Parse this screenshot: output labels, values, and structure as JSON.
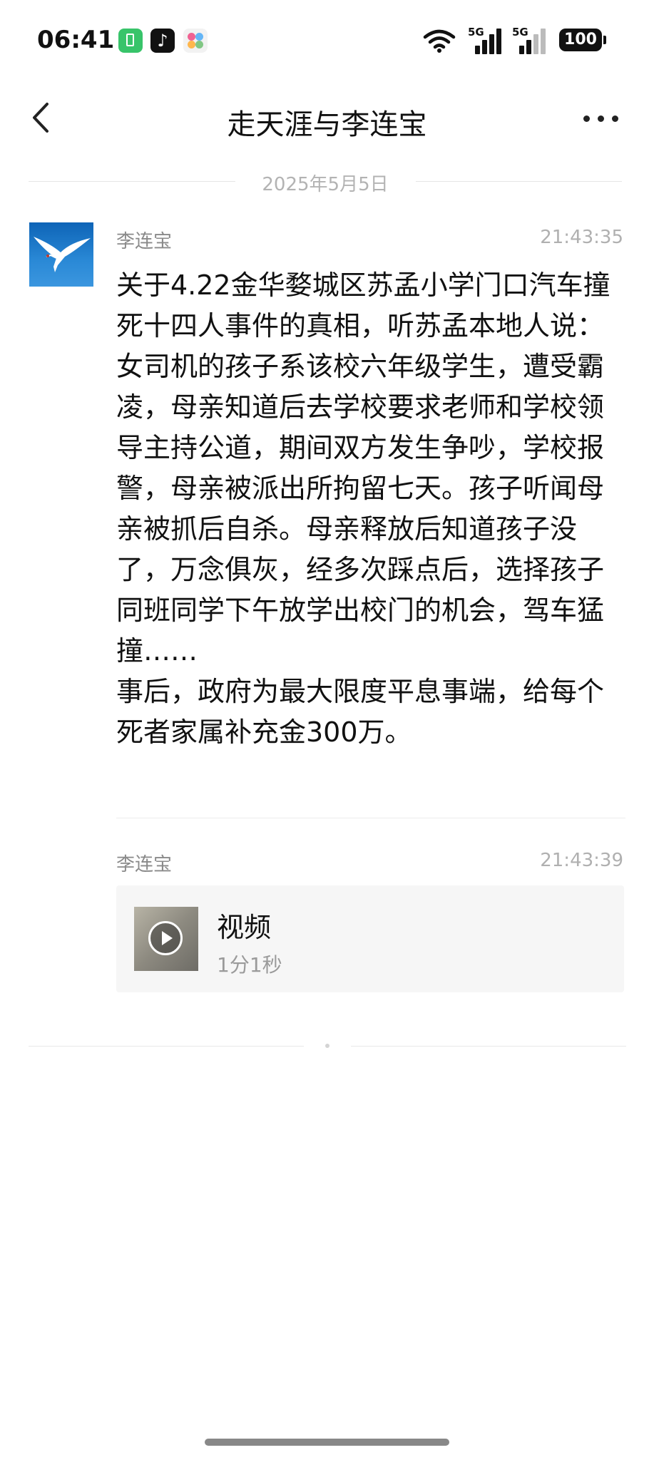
{
  "status_bar": {
    "time": "06:41",
    "network_1": "5G",
    "network_2": "5G",
    "battery": "100"
  },
  "header": {
    "title": "走天涯与李连宝"
  },
  "date_divider": "2025年5月5日",
  "messages": [
    {
      "sender": "李连宝",
      "time": "21:43:35",
      "text": "关于4.22金华婺城区苏孟小学门口汽车撞死十四人事件的真相，听苏孟本地人说：女司机的孩子系该校六年级学生，遭受霸凌，母亲知道后去学校要求老师和学校领导主持公道，期间双方发生争吵，学校报警，母亲被派出所拘留七天。孩子听闻母亲被抓后自杀。母亲释放后知道孩子没了，万念俱灰，经多次踩点后，选择孩子同班同学下午放学出校门的机会，驾车猛撞……\n事后，政府为最大限度平息事端，给每个死者家属补充金300万。"
    },
    {
      "sender": "李连宝",
      "time": "21:43:39",
      "video": {
        "title": "视频",
        "duration": "1分1秒"
      }
    }
  ],
  "colors": {
    "accent_green": "#38c46a",
    "sky_blue": "#2a89d6"
  }
}
